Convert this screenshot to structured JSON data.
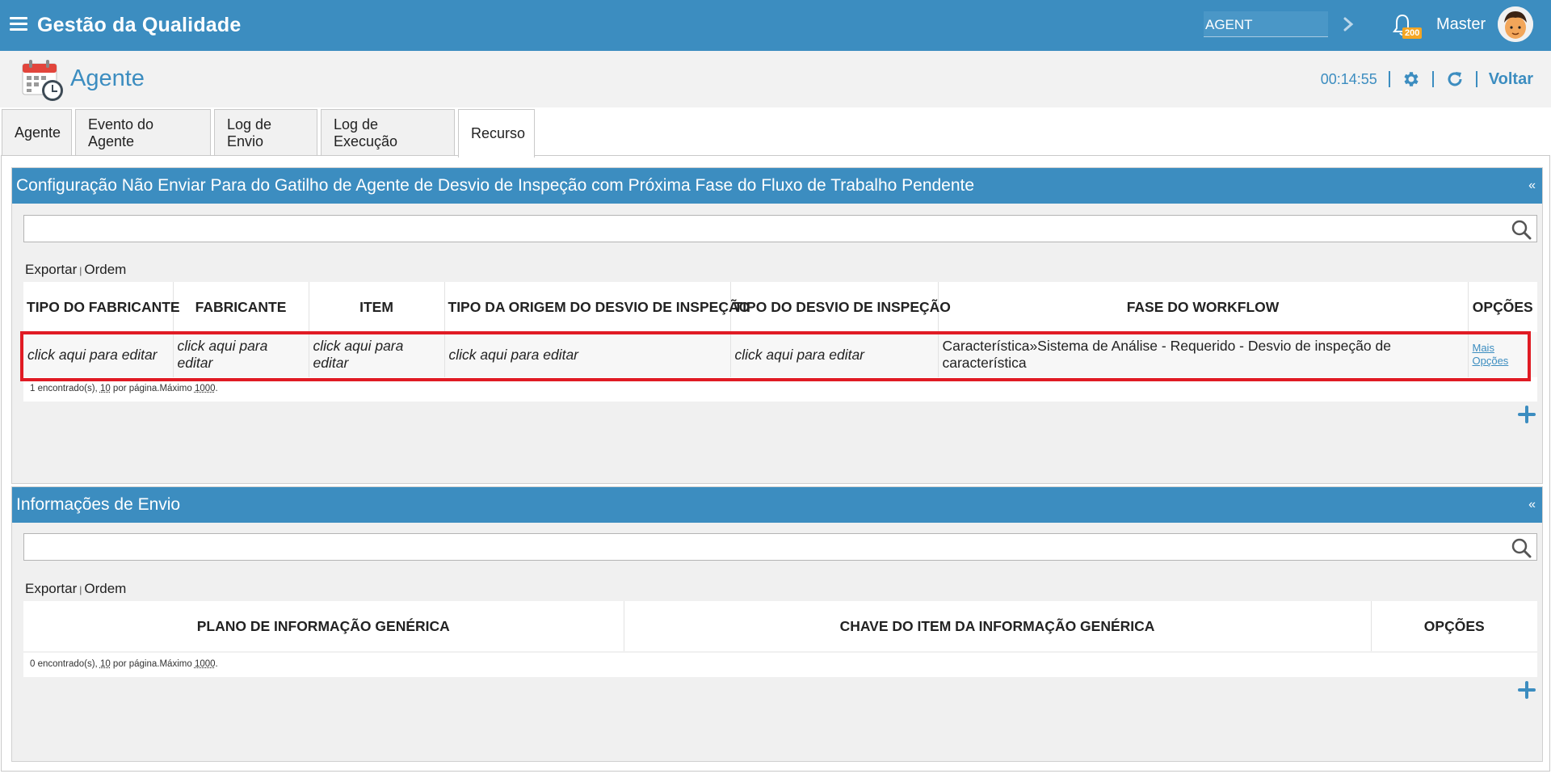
{
  "app": {
    "title": "Gestão da Qualidade"
  },
  "topbar": {
    "search_value": "AGENT",
    "notification_count": "200",
    "user_name": "Master"
  },
  "page": {
    "title": "Agente",
    "timer": "00:14:55",
    "back_label": "Voltar"
  },
  "tabs": [
    {
      "label": "Agente",
      "active": false
    },
    {
      "label": "Evento do Agente",
      "active": false
    },
    {
      "label": "Log de Envio",
      "active": false
    },
    {
      "label": "Log de Execução",
      "active": false
    },
    {
      "label": "Recurso",
      "active": true
    }
  ],
  "panel1": {
    "title": "Configuração Não Enviar Para do Gatilho de Agente de Desvio de Inspeção com Próxima Fase do Fluxo de Trabalho Pendente",
    "collapse_symbol": "«",
    "search_value": "",
    "export_label": "Exportar",
    "order_label": "Ordem",
    "columns": [
      "TIPO DO FABRICANTE",
      "FABRICANTE",
      "ITEM",
      "TIPO DA ORIGEM DO DESVIO DE INSPEÇÃO",
      "TIPO DO DESVIO DE INSPEÇÃO",
      "FASE DO WORKFLOW",
      "OPÇÕES"
    ],
    "rows": [
      {
        "tipo_fabricante": "click aqui para editar",
        "fabricante": "click aqui para editar",
        "item": "click aqui para editar",
        "tipo_origem": "click aqui para editar",
        "tipo_desvio": "click aqui para editar",
        "fase_workflow": "Característica»Sistema de Análise - Requerido - Desvio de inspeção de característica",
        "options_line1": "Mais",
        "options_line2": "Opções"
      }
    ],
    "pager": {
      "found": "1 encontrado(s), ",
      "per_page": "10",
      "per_page_suffix": " por página.Máximo ",
      "max": "1000",
      "end": "."
    }
  },
  "panel2": {
    "title": "Informações de Envio",
    "collapse_symbol": "«",
    "search_value": "",
    "export_label": "Exportar",
    "order_label": "Ordem",
    "columns": [
      "PLANO DE INFORMAÇÃO GENÉRICA",
      "CHAVE DO ITEM DA INFORMAÇÃO GENÉRICA",
      "OPÇÕES"
    ],
    "pager": {
      "found": "0 encontrado(s), ",
      "per_page": "10",
      "per_page_suffix": " por página.Máximo ",
      "max": "1000",
      "end": "."
    }
  },
  "colors": {
    "brand": "#3c8dc0",
    "highlight": "#e01b24",
    "badge": "#f5a623"
  },
  "icons": [
    "menu-icon",
    "chevron-right-icon",
    "bell-icon",
    "avatar",
    "calendar-clock-icon",
    "gear-icon",
    "refresh-icon",
    "search-icon",
    "plus-icon"
  ]
}
